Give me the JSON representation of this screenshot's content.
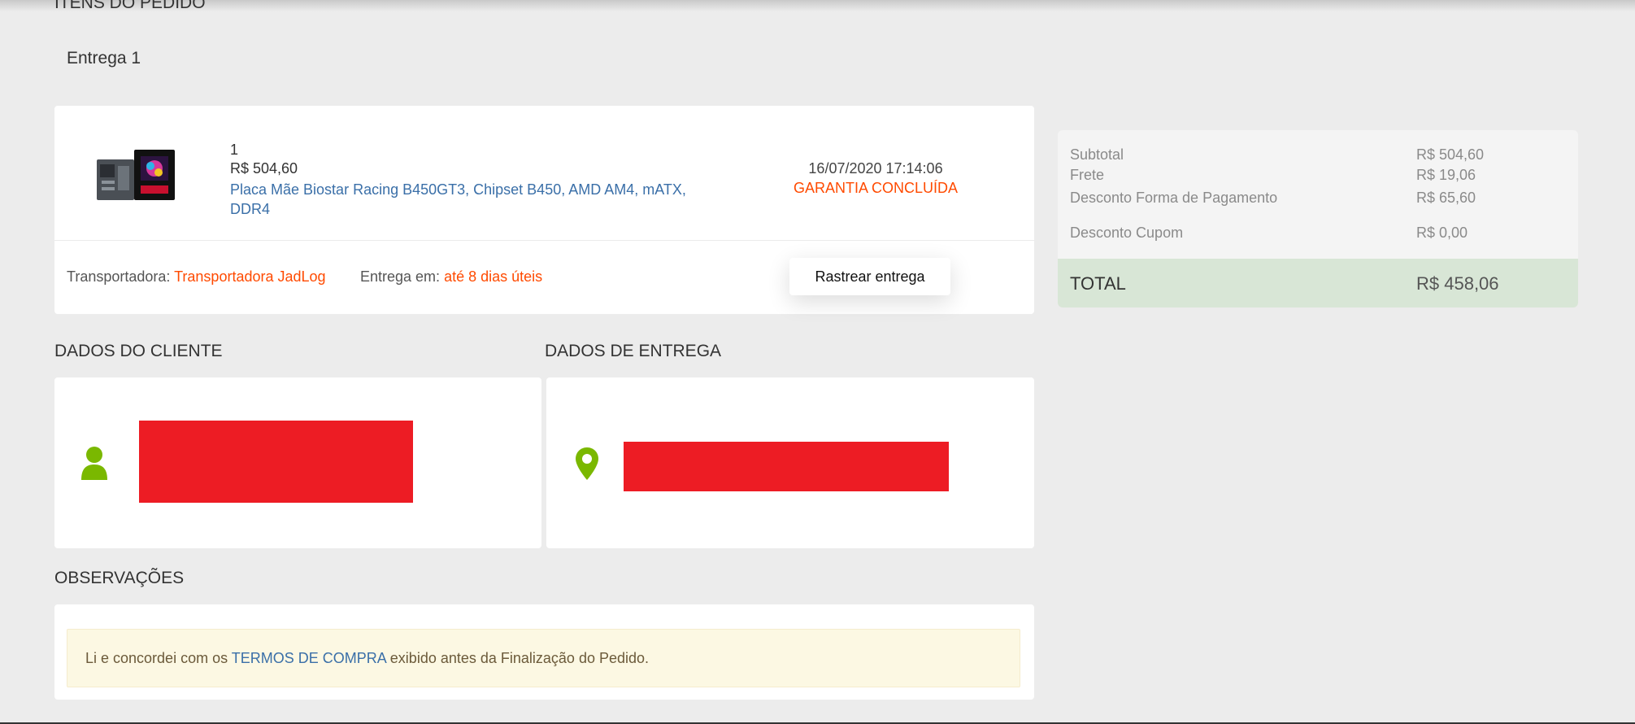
{
  "page": {
    "items_title": "ITENS DO PEDIDO",
    "delivery_label": "Entrega 1"
  },
  "item": {
    "quantity": "1",
    "price": "R$ 504,60",
    "name": "Placa Mãe Biostar Racing B450GT3, Chipset B450, AMD AM4, mATX, DDR4",
    "date": "16/07/2020 17:14:06",
    "warranty_status": "GARANTIA CONCLUÍDA",
    "carrier_label": "Transportadora:",
    "carrier_value": "Transportadora JadLog",
    "delivery_label": "Entrega em:",
    "delivery_value": "até 8 dias úteis",
    "track_button": "Rastrear entrega"
  },
  "summary": {
    "rows": [
      {
        "label": "Subtotal",
        "value": "R$ 504,60"
      },
      {
        "label": "Frete",
        "value": "R$ 19,06"
      },
      {
        "label": "Desconto Forma de Pagamento",
        "value": "R$ 65,60"
      },
      {
        "label": "Desconto Cupom",
        "value": "R$ 0,00"
      }
    ],
    "total_label": "TOTAL",
    "total_value": "R$ 458,06"
  },
  "client": {
    "title": "DADOS DO CLIENTE",
    "icon": "user-icon"
  },
  "shipping": {
    "title": "DADOS DE ENTREGA",
    "icon": "map-pin-icon"
  },
  "observations": {
    "title": "OBSERVAÇÕES",
    "text_before": "Li e concordei com os ",
    "link": "TERMOS DE COMPRA",
    "text_after": " exibido antes da Finalização do Pedido."
  },
  "colors": {
    "accent_orange": "#ff4a00",
    "link_blue": "#3a6fa8",
    "icon_green": "#7ab800",
    "redaction_red": "#ed1c24",
    "total_band": "#d8e6d6"
  }
}
